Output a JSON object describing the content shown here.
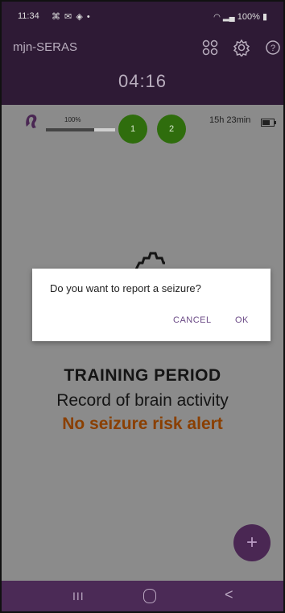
{
  "status_bar": {
    "time": "11:34",
    "left_icons": "⌘ ✉ ◈ •",
    "right": "100%"
  },
  "app_bar": {
    "title": "mjn-SERAS",
    "timer": "04:16",
    "icons": [
      "grid-icon",
      "gear-icon",
      "help-icon"
    ]
  },
  "device": {
    "signal_percent_label": "100%",
    "signal_level": 0.7,
    "channels": [
      "1",
      "2"
    ],
    "battery_remaining": "15h 23min"
  },
  "main": {
    "title": "TRAINING PERIOD",
    "subtitle": "Record of brain activity",
    "alert": "No seizure risk alert"
  },
  "dialog": {
    "message": "Do you want to report a seizure?",
    "cancel_label": "CANCEL",
    "ok_label": "OK"
  },
  "fab": {
    "label": "+"
  },
  "nav_bar": {
    "recents": "III",
    "home": "",
    "back": "<"
  },
  "colors": {
    "app_bar": "#2e1a35",
    "nav_bar": "#4b2a56",
    "channel_circle": "#2f6d0d",
    "alert_text": "#8a3f00",
    "dialog_button": "#6b4a86"
  }
}
